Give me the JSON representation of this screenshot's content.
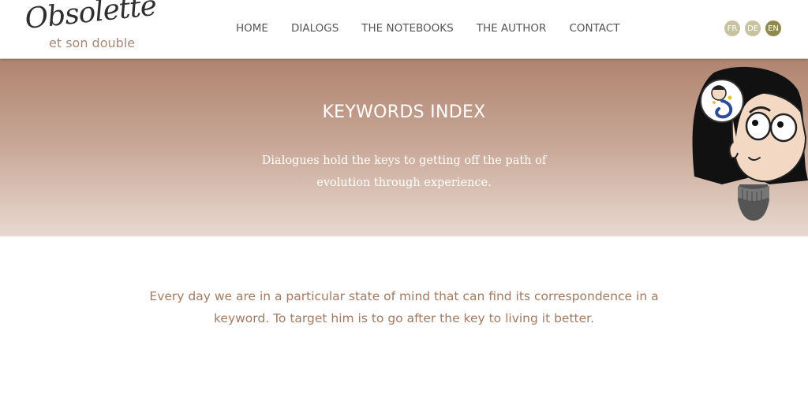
{
  "logo": {
    "main": "Obsolette",
    "sub": "et son double"
  },
  "nav": {
    "items": [
      {
        "label": "HOME"
      },
      {
        "label": "DIALOGS"
      },
      {
        "label": "THE NOTEBOOKS"
      },
      {
        "label": "THE AUTHOR"
      },
      {
        "label": "CONTACT"
      }
    ]
  },
  "languages": [
    {
      "label": "FR",
      "active": false
    },
    {
      "label": "DE",
      "active": false
    },
    {
      "label": "EN",
      "active": true
    }
  ],
  "hero": {
    "title": "KEYWORDS INDEX",
    "subtitle": "Dialogues hold the keys to getting off the path of evolution through experience."
  },
  "intro": {
    "text": "Every day we are in a particular state of mind that can find its correspondence in a keyword. To target him is to go after the key to living it better."
  },
  "colors": {
    "hero_top": "#b08570",
    "hero_bottom": "#e8d9d0",
    "intro_text": "#a07a62",
    "lang_active": "#8f8a4e",
    "lang_inactive": "#c7c2a0"
  }
}
